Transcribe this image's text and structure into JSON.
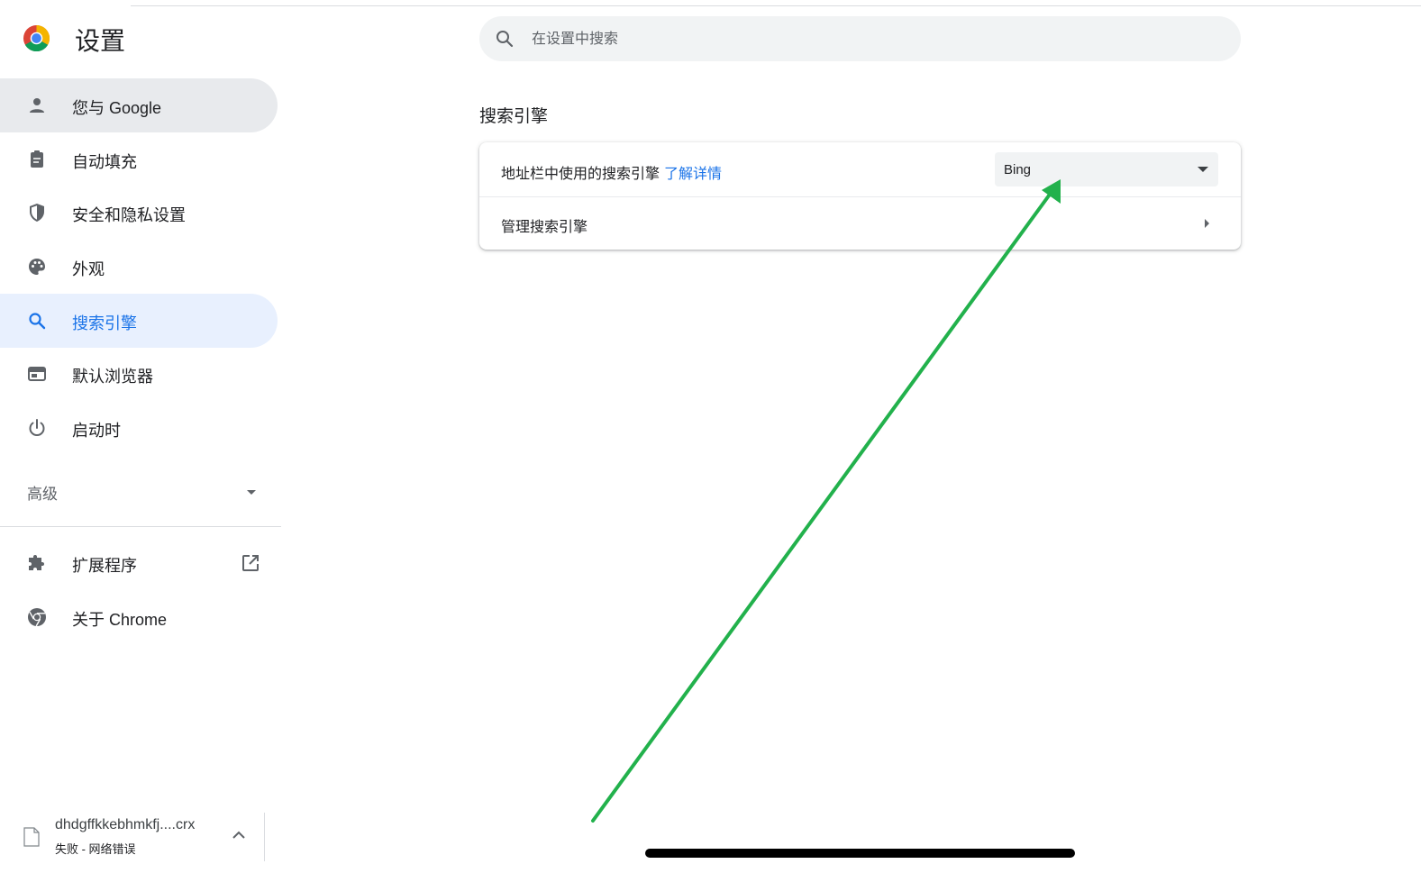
{
  "header": {
    "title": "设置",
    "logo_icon": "chrome-logo-icon"
  },
  "search": {
    "placeholder": "在设置中搜索",
    "value": ""
  },
  "sidebar": {
    "items": [
      {
        "label": "您与 Google",
        "icon": "person-icon",
        "state": "hover"
      },
      {
        "label": "自动填充",
        "icon": "clipboard-icon"
      },
      {
        "label": "安全和隐私设置",
        "icon": "shield-icon"
      },
      {
        "label": "外观",
        "icon": "palette-icon"
      },
      {
        "label": "搜索引擎",
        "icon": "search-icon",
        "state": "selected"
      },
      {
        "label": "默认浏览器",
        "icon": "browser-window-icon"
      },
      {
        "label": "启动时",
        "icon": "power-icon"
      }
    ],
    "advanced_label": "高级",
    "extensions_label": "扩展程序",
    "about_label": "关于 Chrome"
  },
  "main": {
    "section_title": "搜索引擎",
    "address_bar_label": "地址栏中使用的搜索引擎",
    "learn_more_label": "了解详情",
    "engine_selected": "Bing",
    "manage_label": "管理搜索引擎"
  },
  "download": {
    "filename": "dhdgffkkebhmkfj....crx",
    "status": "失败 - 网络错误"
  },
  "colors": {
    "accent": "#1a73e8",
    "active_bg": "#e8f0fe",
    "hover_bg": "#e8eaed",
    "annotation_arrow": "#22b14c"
  }
}
